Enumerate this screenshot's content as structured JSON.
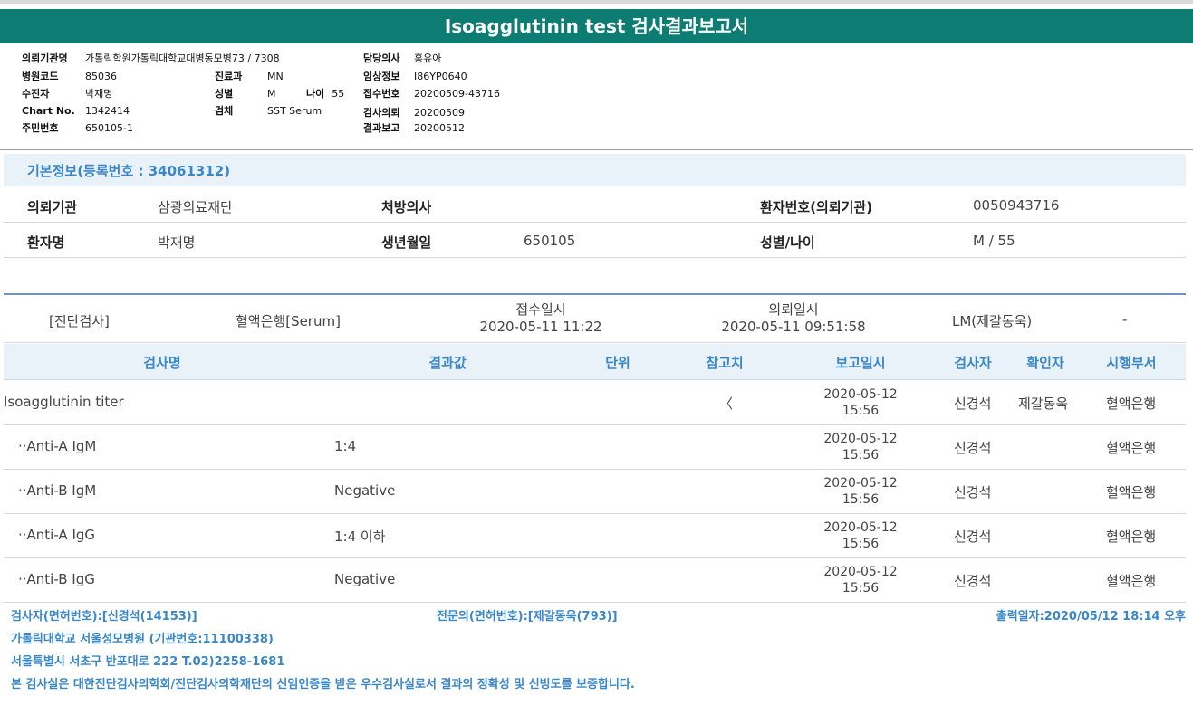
{
  "title": "Isoagglutinin test 검사결과보고서",
  "header": {
    "col1": [
      {
        "label": "의뢰기관명",
        "value": "가톨릭학원가톨릭대학교대병동모병73 / 7308"
      },
      {
        "label": "병원코드",
        "value": "85036"
      },
      {
        "label": "수진자",
        "value": "박재명"
      },
      {
        "label": "Chart No.",
        "value": "1342414"
      },
      {
        "label": "주민번호",
        "value": "650105-1"
      }
    ],
    "col2": [
      {
        "label": "진료과",
        "value": "MN"
      },
      {
        "label": "성별",
        "value": "M"
      },
      {
        "label": "검체",
        "value": "SST Serum"
      }
    ],
    "age_label": "나이",
    "age_value": "55",
    "col3": [
      {
        "label": "담당의사",
        "value": "홍유아"
      },
      {
        "label": "임상정보",
        "value": "I86YP0640"
      },
      {
        "label": "접수번호",
        "value": "20200509-43716"
      },
      {
        "label": "검사의뢰",
        "value": "20200509"
      },
      {
        "label": "결과보고",
        "value": "20200512"
      }
    ]
  },
  "basic_info": {
    "heading": "기본정보(등록번호 : 34061312)",
    "row1": {
      "l1": "의뢰기관",
      "v1": "삼광의료재단",
      "l2": "처방의사",
      "v2": "",
      "l3": "환자번호(의뢰기관)",
      "v3": "0050943716"
    },
    "row2": {
      "l1": "환자명",
      "v1": "박재명",
      "l2": "생년월일",
      "v2": "650105",
      "l3": "성별/나이",
      "v3": "M / 55"
    }
  },
  "summary": {
    "category": "[진단검사]",
    "specimen": "혈액은행[Serum]",
    "received_label": "접수일시",
    "received_value": "2020-05-11 11:22",
    "requested_label": "의뢰일시",
    "requested_value": "2020-05-11 09:51:58",
    "dept": "LM(제갈동욱)",
    "extra": "-"
  },
  "table": {
    "headers": [
      "검사명",
      "결과값",
      "단위",
      "참고치",
      "보고일시",
      "검사자",
      "확인자",
      "시행부서"
    ],
    "rows": [
      {
        "name": "Isoagglutinin titer",
        "result": "",
        "unit": "",
        "ref": "〈",
        "date": "2020-05-12",
        "time": "15:56",
        "tester": "신경석",
        "confirmer": "제갈동욱",
        "dept": "혈액은행"
      },
      {
        "name": "··Anti-A IgM",
        "result": "1:4",
        "unit": "",
        "ref": "",
        "date": "2020-05-12",
        "time": "15:56",
        "tester": "신경석",
        "confirmer": "",
        "dept": "혈액은행"
      },
      {
        "name": "··Anti-B IgM",
        "result": "Negative",
        "unit": "",
        "ref": "",
        "date": "2020-05-12",
        "time": "15:56",
        "tester": "신경석",
        "confirmer": "",
        "dept": "혈액은행"
      },
      {
        "name": "··Anti-A IgG",
        "result": "1:4 이하",
        "unit": "",
        "ref": "",
        "date": "2020-05-12",
        "time": "15:56",
        "tester": "신경석",
        "confirmer": "",
        "dept": "혈액은행"
      },
      {
        "name": "··Anti-B IgG",
        "result": "Negative",
        "unit": "",
        "ref": "",
        "date": "2020-05-12",
        "time": "15:56",
        "tester": "신경석",
        "confirmer": "",
        "dept": "혈액은행"
      }
    ]
  },
  "footer": {
    "tester": "검사자(면허번호):[신경석(14153)]",
    "specialist": "전문의(면허번호):[제갈동욱(793)]",
    "printed": "출력일자:2020/05/12 18:14 오후",
    "hospital": "가톨릭대학교 서울성모병원 (기관번호:11100338)",
    "address": "서울특별시 서초구 반포대로 222 T.02)2258-1681",
    "certification": "본 검사실은 대한진단검사의학회/진단검사의학재단의 신임인증을 받은 우수검사실로서 결과의 정확성 및 신빙도를 보증합니다."
  }
}
